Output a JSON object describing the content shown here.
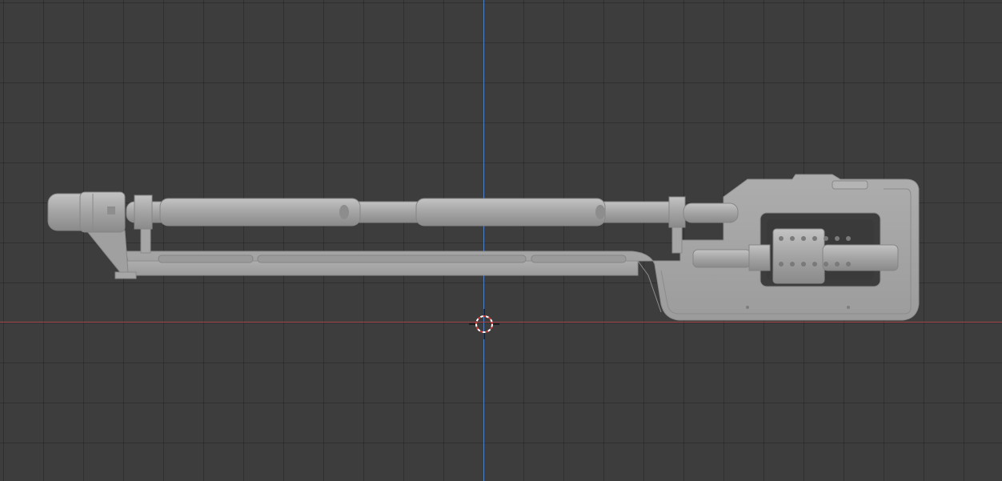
{
  "viewport": {
    "view": "front-orthographic",
    "grid": true,
    "background_color": "#3d3d3d",
    "grid_color": "#333333",
    "x_axis_color": "#a8474d",
    "y_axis_color": "#4f7fc5",
    "object_color": "#a9a9a9"
  },
  "object": {
    "icon": "rifle-mesh",
    "shading": "solid"
  },
  "cursor": {
    "icon": "3d-cursor-icon"
  }
}
